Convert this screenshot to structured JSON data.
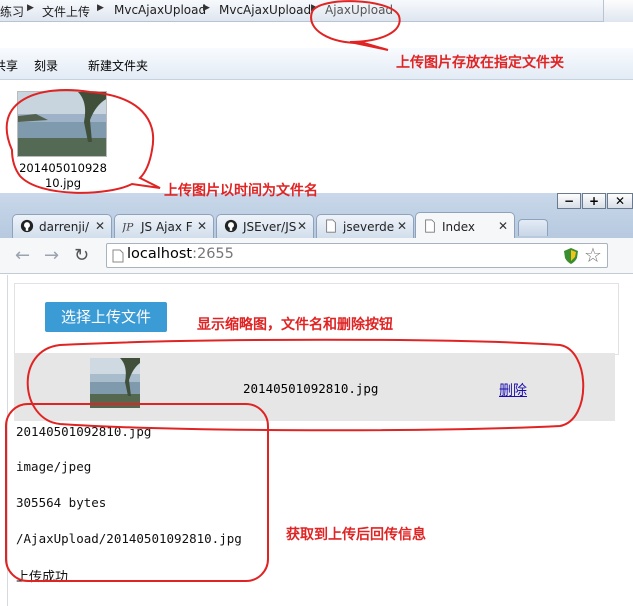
{
  "explorer": {
    "breadcrumbs": [
      "练习",
      "文件上传",
      "MvcAjaxUpload",
      "MvcAjaxUpload",
      "AjaxUpload"
    ],
    "toolbar": [
      "共享",
      "刻录",
      "新建文件夹"
    ],
    "file": {
      "name": "20140501092810.jpg",
      "icon": "image-thumbnail"
    }
  },
  "browser": {
    "window_controls": {
      "minimize": "−",
      "maximize": "+"
    },
    "tabs": [
      {
        "label": "darrenji/",
        "icon": "github-icon"
      },
      {
        "label": "JS Ajax F",
        "icon": "jsfiddle-icon"
      },
      {
        "label": "JSEver/JS",
        "icon": "github-icon"
      },
      {
        "label": "jseverde",
        "icon": "page-icon"
      },
      {
        "label": "Index",
        "icon": "page-icon",
        "active": true
      }
    ],
    "url_host": "localhost",
    "url_port": ":2655",
    "page": {
      "upload_button": "选择上传文件",
      "row": {
        "file_name": "20140501092810.jpg",
        "delete_link": "删除"
      },
      "info": [
        "20140501092810.jpg",
        "image/jpeg",
        "305564 bytes",
        "/AjaxUpload/20140501092810.jpg",
        "上传成功"
      ]
    }
  },
  "annotations": {
    "save_folder": "上传图片存放在指定文件夹",
    "time_name": "上传图片以时间为文件名",
    "show_thumb": "显示缩略图，文件名和删除按钮",
    "return_info": "获取到上传后回传信息"
  },
  "colors": {
    "annotation": "#e02424",
    "upload_button": "#3a9bd5",
    "link": "#1a0dab"
  }
}
